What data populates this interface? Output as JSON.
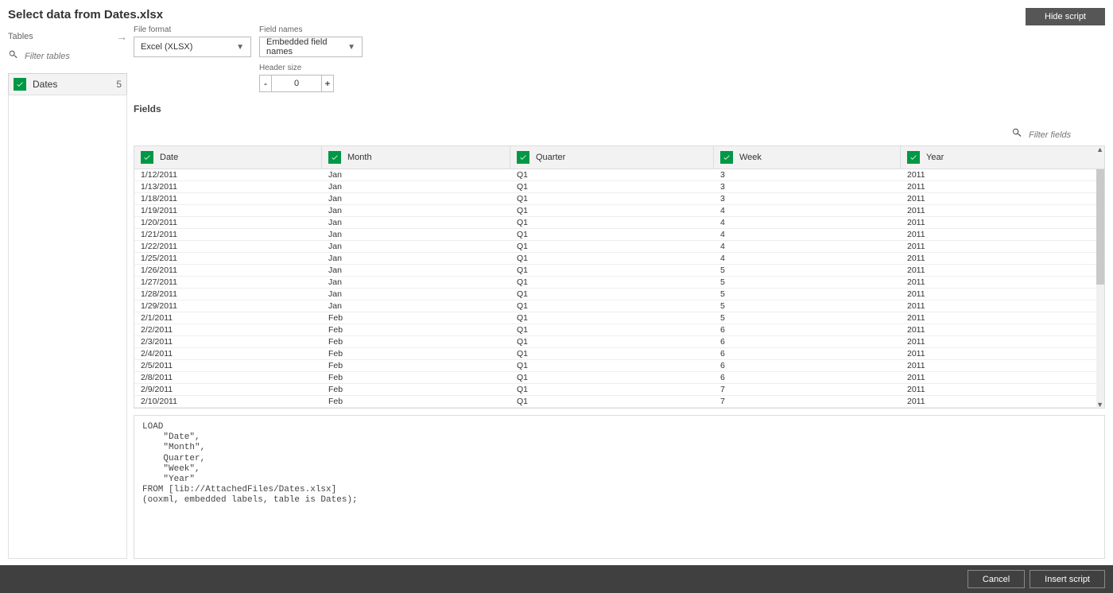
{
  "title": "Select data from Dates.xlsx",
  "hide_script": "Hide script",
  "left": {
    "tables_label": "Tables",
    "filter_placeholder": "Filter tables",
    "table_name": "Dates",
    "table_count": "5"
  },
  "controls": {
    "file_format_label": "File format",
    "file_format_value": "Excel (XLSX)",
    "field_names_label": "Field names",
    "field_names_value": "Embedded field names",
    "header_size_label": "Header size",
    "header_size_value": "0"
  },
  "fields_label": "Fields",
  "filter_fields_placeholder": "Filter fields",
  "columns": {
    "date": "Date",
    "month": "Month",
    "quarter": "Quarter",
    "week": "Week",
    "year": "Year"
  },
  "rows": [
    {
      "date": "1/12/2011",
      "month": "Jan",
      "quarter": "Q1",
      "week": "3",
      "year": "2011"
    },
    {
      "date": "1/13/2011",
      "month": "Jan",
      "quarter": "Q1",
      "week": "3",
      "year": "2011"
    },
    {
      "date": "1/18/2011",
      "month": "Jan",
      "quarter": "Q1",
      "week": "3",
      "year": "2011"
    },
    {
      "date": "1/19/2011",
      "month": "Jan",
      "quarter": "Q1",
      "week": "4",
      "year": "2011"
    },
    {
      "date": "1/20/2011",
      "month": "Jan",
      "quarter": "Q1",
      "week": "4",
      "year": "2011"
    },
    {
      "date": "1/21/2011",
      "month": "Jan",
      "quarter": "Q1",
      "week": "4",
      "year": "2011"
    },
    {
      "date": "1/22/2011",
      "month": "Jan",
      "quarter": "Q1",
      "week": "4",
      "year": "2011"
    },
    {
      "date": "1/25/2011",
      "month": "Jan",
      "quarter": "Q1",
      "week": "4",
      "year": "2011"
    },
    {
      "date": "1/26/2011",
      "month": "Jan",
      "quarter": "Q1",
      "week": "5",
      "year": "2011"
    },
    {
      "date": "1/27/2011",
      "month": "Jan",
      "quarter": "Q1",
      "week": "5",
      "year": "2011"
    },
    {
      "date": "1/28/2011",
      "month": "Jan",
      "quarter": "Q1",
      "week": "5",
      "year": "2011"
    },
    {
      "date": "1/29/2011",
      "month": "Jan",
      "quarter": "Q1",
      "week": "5",
      "year": "2011"
    },
    {
      "date": "2/1/2011",
      "month": "Feb",
      "quarter": "Q1",
      "week": "5",
      "year": "2011"
    },
    {
      "date": "2/2/2011",
      "month": "Feb",
      "quarter": "Q1",
      "week": "6",
      "year": "2011"
    },
    {
      "date": "2/3/2011",
      "month": "Feb",
      "quarter": "Q1",
      "week": "6",
      "year": "2011"
    },
    {
      "date": "2/4/2011",
      "month": "Feb",
      "quarter": "Q1",
      "week": "6",
      "year": "2011"
    },
    {
      "date": "2/5/2011",
      "month": "Feb",
      "quarter": "Q1",
      "week": "6",
      "year": "2011"
    },
    {
      "date": "2/8/2011",
      "month": "Feb",
      "quarter": "Q1",
      "week": "6",
      "year": "2011"
    },
    {
      "date": "2/9/2011",
      "month": "Feb",
      "quarter": "Q1",
      "week": "7",
      "year": "2011"
    },
    {
      "date": "2/10/2011",
      "month": "Feb",
      "quarter": "Q1",
      "week": "7",
      "year": "2011"
    }
  ],
  "script_text": "LOAD\n    \"Date\",\n    \"Month\",\n    Quarter,\n    \"Week\",\n    \"Year\"\nFROM [lib://AttachedFiles/Dates.xlsx]\n(ooxml, embedded labels, table is Dates);",
  "footer": {
    "cancel": "Cancel",
    "insert": "Insert script"
  }
}
